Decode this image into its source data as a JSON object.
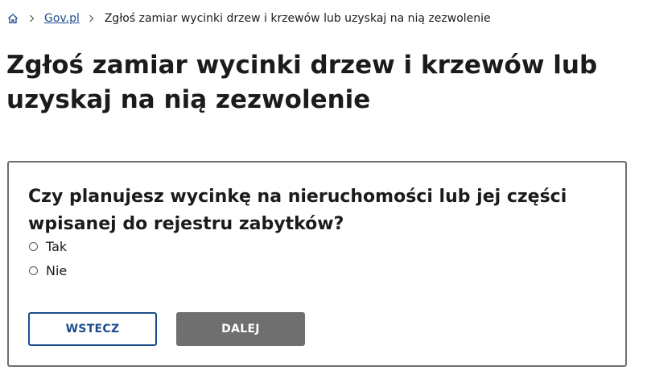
{
  "breadcrumb": {
    "home_icon": "home-icon",
    "separator_icon": "chevron-right-icon",
    "link_label": "Gov.pl",
    "current_label": "Zgłoś zamiar wycinki drzew i krzewów lub uzyskaj na nią zezwolenie"
  },
  "page": {
    "title": "Zgłoś zamiar wycinki drzew i krzewów lub uzyskaj na nią zezwolenie"
  },
  "question": {
    "text": "Czy planujesz wycinkę na nieruchomości lub jej części wpisanej do rejestru zabytków?",
    "options": [
      {
        "label": "Tak",
        "selected": false
      },
      {
        "label": "Nie",
        "selected": false
      }
    ]
  },
  "buttons": {
    "back_label": "WSTECZ",
    "next_label": "DALEJ"
  },
  "colors": {
    "link": "#1c4c8c",
    "text": "#1b1b1b",
    "border": "#6f6f6f",
    "disabled_button": "#6f6f6f"
  }
}
